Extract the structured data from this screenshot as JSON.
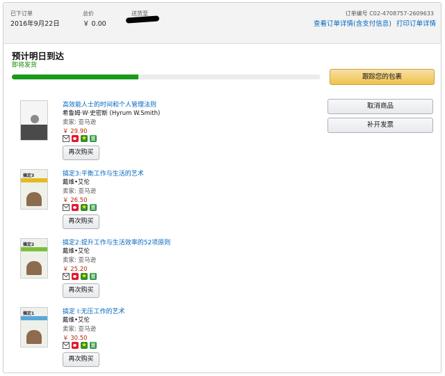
{
  "header": {
    "order_date_label": "已下订单",
    "order_date": "2016年9月22日",
    "total_label": "总价",
    "total": "￥ 0.00",
    "ship_to_label": "送货至",
    "order_number": "订单编号 C02-4708757-2609633",
    "details_link": "查看订单详情(含支付信息)",
    "print_link": "打印订单详情"
  },
  "delivery": {
    "title": "预计明日到达",
    "status": "即将发货",
    "progress": 0.41,
    "progress_color": "#1a9a1a"
  },
  "actions": {
    "track": "跟踪您的包裹",
    "cancel": "取消商品",
    "invoice": "补开发票"
  },
  "items": [
    {
      "title": "高效能人士的时间和个人管理法则",
      "author": "希鲁姆·W·史密斯 (Hyrum W.Smith)",
      "seller": "卖家: 亚马逊",
      "price": "￥ 29.90",
      "rebuy": "再次购买"
    },
    {
      "title": "搞定3:平衡工作与生活的艺术",
      "author": "戴维•艾伦",
      "seller": "卖家: 亚马逊",
      "price": "￥ 26.50",
      "rebuy": "再次购买",
      "cover_title": "搞定3"
    },
    {
      "title": "搞定2:提升工作与生活效率的52项原则",
      "author": "戴维•艾伦",
      "seller": "卖家: 亚马逊",
      "price": "￥ 25.20",
      "rebuy": "再次购买",
      "cover_title": "搞定2"
    },
    {
      "title": "搞定 I:无压工作的艺术",
      "author": "戴维•艾伦",
      "seller": "卖家: 亚马逊",
      "price": "￥ 30.50",
      "rebuy": "再次购买",
      "cover_title": "搞定1"
    }
  ],
  "share_icons": [
    "mail-icon",
    "weibo-icon",
    "favorite-icon",
    "douban-icon"
  ],
  "colors": {
    "link": "#0066c0",
    "price": "#b12704",
    "status_green": "#118a00",
    "primary_button": "#f0c14b"
  }
}
